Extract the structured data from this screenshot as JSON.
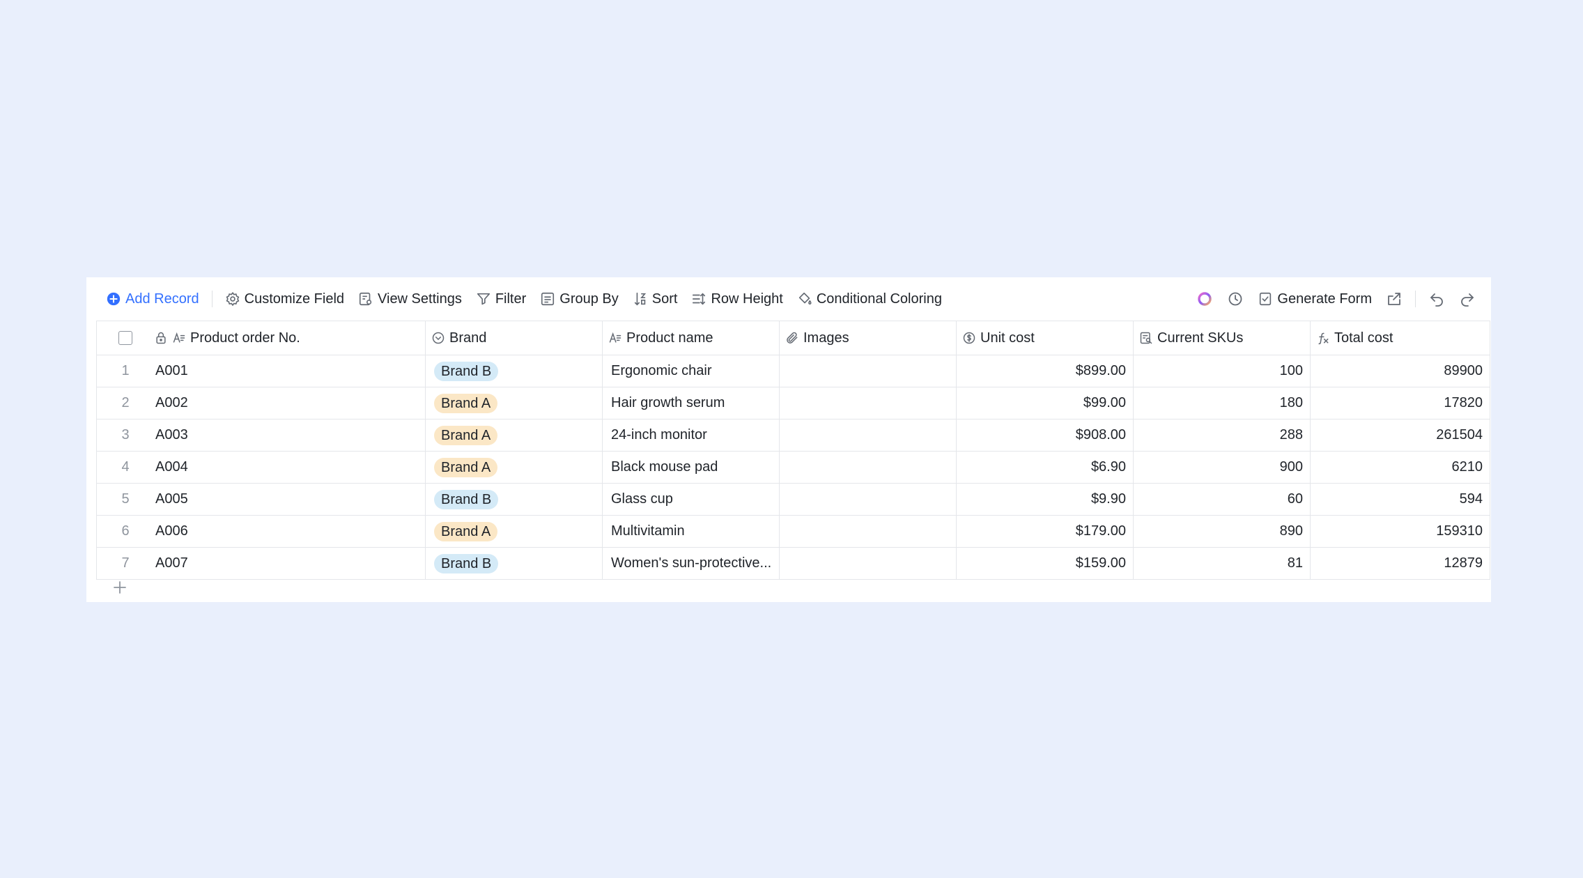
{
  "toolbar": {
    "add_record": "Add Record",
    "customize_field": "Customize Field",
    "view_settings": "View Settings",
    "filter": "Filter",
    "group_by": "Group By",
    "sort": "Sort",
    "row_height": "Row Height",
    "conditional_coloring": "Conditional Coloring",
    "generate_form": "Generate Form"
  },
  "columns": {
    "order_no": "Product order No.",
    "brand": "Brand",
    "product_name": "Product name",
    "images": "Images",
    "unit_cost": "Unit cost",
    "current_skus": "Current SKUs",
    "total_cost": "Total cost"
  },
  "rows": [
    {
      "index": "1",
      "order_no": "A001",
      "brand": "Brand B",
      "product_name": "Ergonomic chair",
      "unit_cost": "$899.00",
      "skus": "100",
      "total": "89900"
    },
    {
      "index": "2",
      "order_no": "A002",
      "brand": "Brand A",
      "product_name": "Hair growth serum",
      "unit_cost": "$99.00",
      "skus": "180",
      "total": "17820"
    },
    {
      "index": "3",
      "order_no": "A003",
      "brand": "Brand A",
      "product_name": "24-inch monitor",
      "unit_cost": "$908.00",
      "skus": "288",
      "total": "261504"
    },
    {
      "index": "4",
      "order_no": "A004",
      "brand": "Brand A",
      "product_name": "Black mouse pad",
      "unit_cost": "$6.90",
      "skus": "900",
      "total": "6210"
    },
    {
      "index": "5",
      "order_no": "A005",
      "brand": "Brand B",
      "product_name": "Glass cup",
      "unit_cost": "$9.90",
      "skus": "60",
      "total": "594"
    },
    {
      "index": "6",
      "order_no": "A006",
      "brand": "Brand A",
      "product_name": "Multivitamin",
      "unit_cost": "$179.00",
      "skus": "890",
      "total": "159310"
    },
    {
      "index": "7",
      "order_no": "A007",
      "brand": "Brand B",
      "product_name": "Women's sun-protective...",
      "unit_cost": "$159.00",
      "skus": "81",
      "total": "12879"
    }
  ],
  "colors": {
    "background": "#e9effc",
    "accent": "#3370ff",
    "brand_a_tag": "#fbe7c6",
    "brand_b_tag": "#d4eaf7"
  }
}
